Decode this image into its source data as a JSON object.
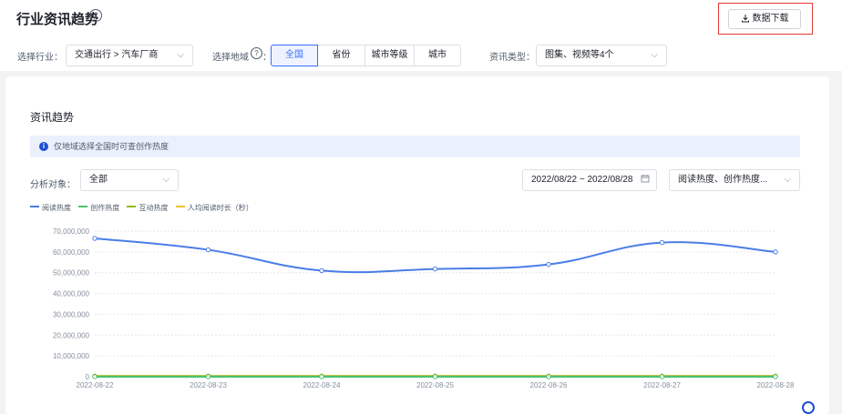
{
  "header": {
    "title": "行业资讯趋势",
    "help_icon": "question-circle-icon",
    "download_label": "数据下载"
  },
  "filters": {
    "industry_label": "选择行业：",
    "industry_value": "交通出行 > 汽车厂商",
    "region_label": "选择地域",
    "region_colon": "：",
    "region_options": [
      "全国",
      "省份",
      "城市等级",
      "城市"
    ],
    "region_selected": "全国",
    "type_label": "资讯类型：",
    "type_value": "图集、视频等4个"
  },
  "section": {
    "title": "资讯趋势",
    "notice": "仅地域选择全国时可查创作热度",
    "target_label": "分析对象：",
    "target_value": "全部",
    "date_range": "2022/08/22 ~ 2022/08/28",
    "metrics_value": "阅读热度、创作热度..."
  },
  "colors": {
    "accent": "#3a6ff8",
    "highlight_border": "#e53935"
  },
  "chart_data": {
    "type": "line",
    "categories": [
      "2022-08-22",
      "2022-08-23",
      "2022-08-24",
      "2022-08-25",
      "2022-08-26",
      "2022-08-27",
      "2022-08-28"
    ],
    "series": [
      {
        "name": "阅读热度",
        "color": "#4a7ee6",
        "values": [
          66500000,
          61000000,
          51000000,
          51800000,
          54000000,
          64500000,
          60000000
        ]
      },
      {
        "name": "创作热度",
        "color": "#4cc26f",
        "values": [
          0,
          0,
          0,
          0,
          0,
          0,
          0
        ]
      },
      {
        "name": "互动热度",
        "color": "#8fb81a",
        "values": [
          0,
          0,
          0,
          0,
          0,
          0,
          0
        ]
      },
      {
        "name": "人均阅读时长（秒）",
        "color": "#f2c233",
        "values": [
          0,
          0,
          0,
          0,
          0,
          0,
          0
        ]
      }
    ],
    "yticks": [
      "70,000,000",
      "60,000,000",
      "50,000,000",
      "40,000,000",
      "30,000,000",
      "20,000,000",
      "10,000,000",
      "0"
    ],
    "ylim": [
      0,
      70000000
    ],
    "grid": true,
    "legend_position": "top-left"
  }
}
